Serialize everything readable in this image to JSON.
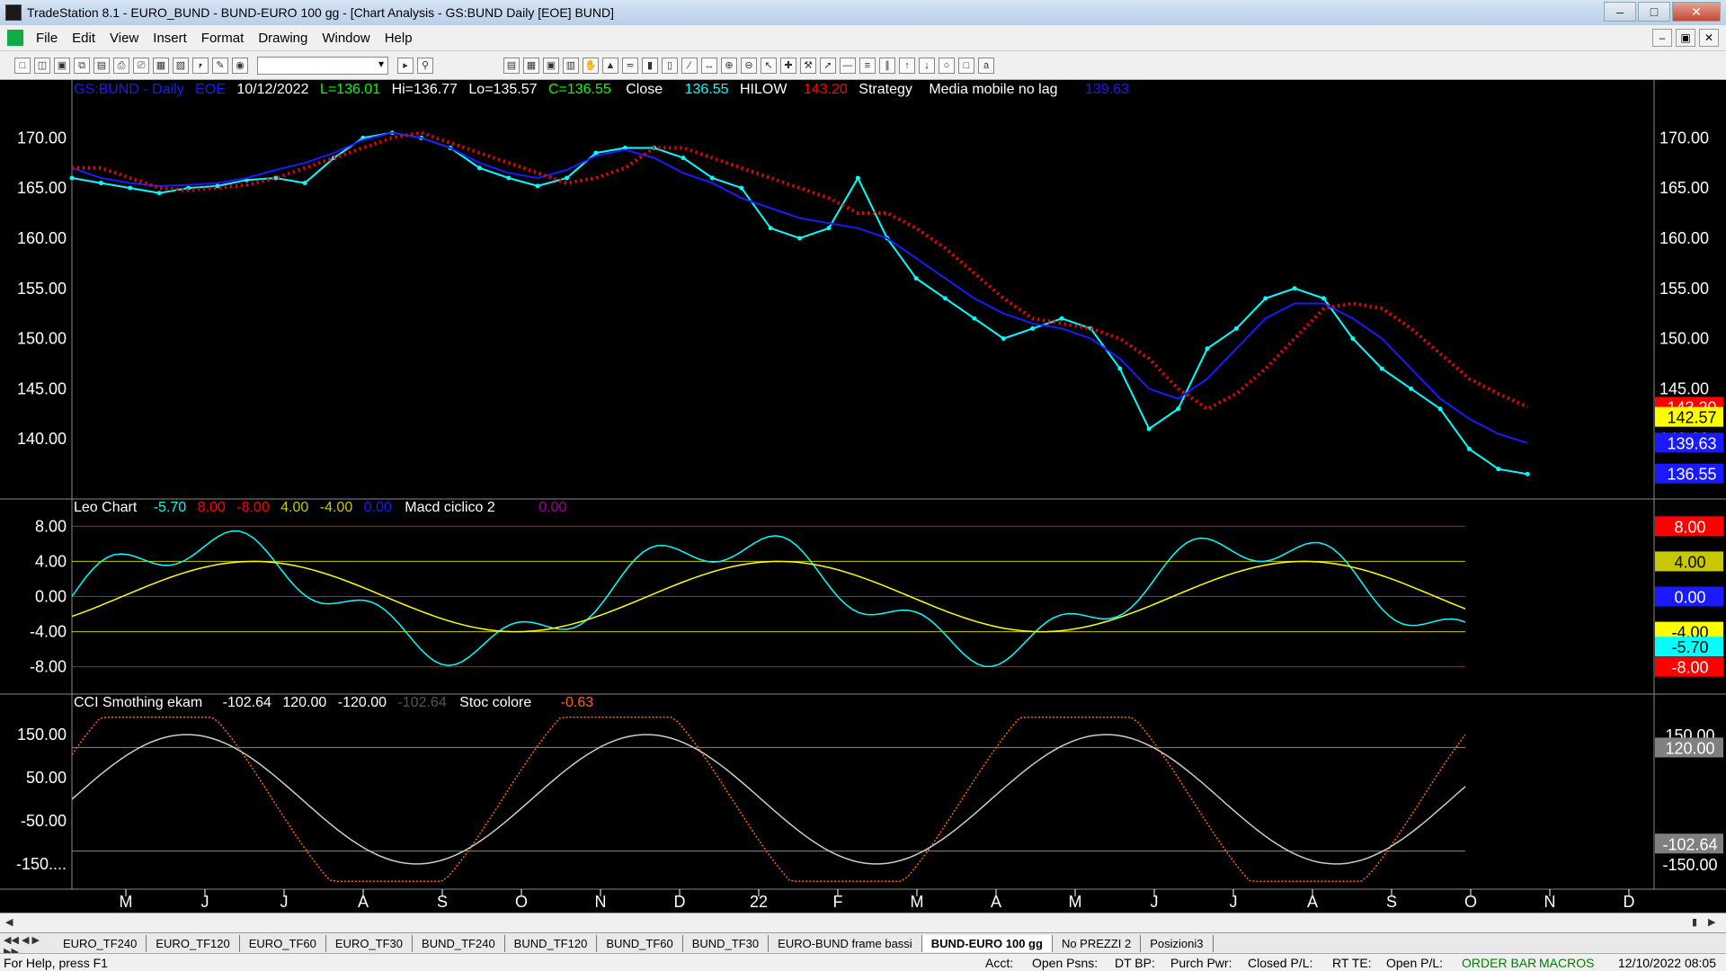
{
  "window": {
    "title": "TradeStation 8.1 - EURO_BUND - BUND-EURO 100 gg - [Chart Analysis - GS:BUND  Daily  [EOE] BUND]"
  },
  "menu": [
    "File",
    "Edit",
    "View",
    "Insert",
    "Format",
    "Drawing",
    "Window",
    "Help"
  ],
  "price_header": {
    "symbol": "GS:BUND - Daily",
    "session": "EOE",
    "date": "10/12/2022",
    "low": "L=136.01",
    "high": "Hi=136.77",
    "lo": "Lo=135.57",
    "close": "C=136.55",
    "close_label": "Close",
    "close_value": "136.55",
    "hilow_label": "HILOW",
    "hilow_value": "143.20",
    "strategy": "Strategy",
    "ma_label": "Media mobile no lag",
    "ma_value": "139.63"
  },
  "price_axis": {
    "ticks": [
      "170.00",
      "165.00",
      "160.00",
      "155.00",
      "150.00",
      "145.00",
      "140.00"
    ],
    "tick_values": [
      170,
      165,
      160,
      155,
      150,
      145,
      140
    ],
    "badges": [
      {
        "text": "143.20",
        "value": 143.2,
        "bg": "#ff0000",
        "fg": "#ffffff"
      },
      {
        "text": "142.57",
        "value": 142.2,
        "bg": "#ffff00",
        "fg": "#000000"
      },
      {
        "text": "139.63",
        "value": 139.63,
        "bg": "#1a1aff",
        "fg": "#ffffff"
      },
      {
        "text": "136.55",
        "value": 136.55,
        "bg": "#1a1aff",
        "fg": "#ffffff"
      }
    ]
  },
  "macd_header": {
    "name": "Leo Chart",
    "v1": "-5.70",
    "v2": "8.00",
    "v3": "-8.00",
    "v4": "4.00",
    "v5": "-4.00",
    "v6": "0.00",
    "name2": "Macd ciclico 2",
    "v7": "0.00"
  },
  "macd_axis": {
    "ticks": [
      "8.00",
      "4.00",
      "0.00",
      "-4.00",
      "-8.00"
    ],
    "tick_values": [
      8,
      4,
      0,
      -4,
      -8
    ],
    "badges": [
      {
        "text": "8.00",
        "value": 8,
        "bg": "#ff0000",
        "fg": "#ffffff"
      },
      {
        "text": "4.00",
        "value": 4,
        "bg": "#c8c800",
        "fg": "#000000"
      },
      {
        "text": "0.00",
        "value": 0,
        "bg": "#1a1aff",
        "fg": "#ffffff"
      },
      {
        "text": "-4.00",
        "value": -4,
        "bg": "#ffff00",
        "fg": "#000000"
      },
      {
        "text": "-5.70",
        "value": -5.7,
        "bg": "#00ffff",
        "fg": "#000000"
      },
      {
        "text": "-8.00",
        "value": -8,
        "bg": "#ff0000",
        "fg": "#ffffff"
      }
    ]
  },
  "cci_header": {
    "name": "CCI Smothing ekam",
    "v1": "-102.64",
    "v2": "120.00",
    "v3": "-120.00",
    "v4": "-102.64",
    "name2": "Stoc colore",
    "v5": "-0.63"
  },
  "cci_axis": {
    "ticks": [
      "150.00",
      "50.00",
      "-50.00",
      "-150...."
    ],
    "tick_values": [
      150,
      50,
      -50,
      -150
    ],
    "badges": [
      {
        "text": "150.00",
        "value": 150,
        "bg": "#000000",
        "fg": "#ffffff"
      },
      {
        "text": "120.00",
        "value": 120,
        "bg": "#808080",
        "fg": "#ffffff"
      },
      {
        "text": "-102.64",
        "value": -102.64,
        "bg": "#808080",
        "fg": "#ffffff"
      },
      {
        "text": "-150.00",
        "value": -150,
        "bg": "#000000",
        "fg": "#ffffff"
      }
    ]
  },
  "time_axis": {
    "months": [
      "M",
      "J",
      "J",
      "A",
      "S",
      "O",
      "N",
      "D",
      "22",
      "F",
      "M",
      "A",
      "M",
      "J",
      "J",
      "A",
      "S",
      "O",
      "N",
      "D"
    ]
  },
  "tabs": [
    "EURO_TF240",
    "EURO_TF120",
    "EURO_TF60",
    "EURO_TF30",
    "BUND_TF240",
    "BUND_TF120",
    "BUND_TF60",
    "BUND_TF30",
    "EURO-BUND frame bassi",
    "BUND-EURO 100 gg",
    "No PREZZI 2",
    "Posizioni3"
  ],
  "active_tab": "BUND-EURO 100 gg",
  "status": {
    "help": "For Help, press F1",
    "acct": "Acct:",
    "open_psns": "Open Psns:",
    "dt_bp": "DT BP:",
    "purch_pwr": "Purch Pwr:",
    "closed_pl": "Closed P/L:",
    "rt_te": "RT TE:",
    "open_pl": "Open P/L:",
    "order_bar": "ORDER BAR",
    "macros": "MACROS",
    "datetime": "12/10/2022 08:05"
  },
  "colors": {
    "background": "#000000",
    "cyan": "#00ffff",
    "red": "#ff0000",
    "green": "#00ff00",
    "blue": "#1a1aff",
    "yellow": "#ffff00",
    "orange": "#ff6600"
  },
  "chart_data": {
    "type": "line",
    "title": "GS:BUND - Daily",
    "xlabel": "",
    "ylabel": "",
    "ylim": [
      135,
      172
    ],
    "x": [
      0,
      0.02,
      0.04,
      0.06,
      0.08,
      0.1,
      0.12,
      0.14,
      0.16,
      0.18,
      0.2,
      0.22,
      0.24,
      0.26,
      0.28,
      0.3,
      0.32,
      0.34,
      0.36,
      0.38,
      0.4,
      0.42,
      0.44,
      0.46,
      0.48,
      0.5,
      0.52,
      0.54,
      0.56,
      0.58,
      0.6,
      0.62,
      0.64,
      0.66,
      0.68,
      0.7,
      0.72,
      0.74,
      0.76,
      0.78,
      0.8,
      0.82,
      0.84,
      0.86,
      0.88,
      0.9,
      0.92,
      0.94,
      0.96,
      0.98,
      1.0
    ],
    "series": [
      {
        "name": "Close",
        "values": [
          166,
          165.5,
          165,
          164.5,
          165,
          165.2,
          165.8,
          166,
          165.5,
          168,
          170,
          170.5,
          170,
          169,
          167,
          166,
          165.2,
          166,
          168.5,
          169,
          169,
          168,
          166,
          165,
          161,
          160,
          161,
          166,
          160,
          156,
          154,
          152,
          150,
          151,
          152,
          151,
          147,
          141,
          143,
          149,
          151,
          154,
          155,
          154,
          150,
          147,
          145,
          143,
          139,
          137,
          136.5
        ]
      },
      {
        "name": "Media mobile no lag",
        "values": [
          167,
          166,
          165.5,
          165.2,
          165.3,
          165.5,
          166,
          166.8,
          167.5,
          168.5,
          169.8,
          170.5,
          170,
          169,
          167.5,
          166.5,
          166,
          166.8,
          168.2,
          168.8,
          168,
          166.5,
          165.5,
          164,
          163,
          162,
          161.5,
          161,
          160,
          158,
          156,
          154,
          152.5,
          151.5,
          151,
          150,
          148,
          145,
          144,
          146,
          149,
          152,
          153.5,
          153.5,
          152,
          150,
          147,
          144,
          142,
          140.5,
          139.6
        ]
      },
      {
        "name": "HILOW",
        "values": [
          167,
          167,
          166,
          165,
          164.8,
          165,
          165.3,
          166,
          167,
          168,
          169,
          170,
          170.5,
          169.5,
          168.5,
          167.5,
          166.5,
          165.5,
          166,
          167,
          169,
          169,
          168,
          167,
          166,
          165,
          164,
          162.5,
          162.5,
          161,
          159,
          156.5,
          154,
          152,
          151.5,
          151,
          150,
          148,
          145,
          143,
          144.5,
          147,
          150,
          153,
          153.5,
          153,
          151,
          148.5,
          146,
          144.5,
          143.2
        ]
      }
    ]
  }
}
